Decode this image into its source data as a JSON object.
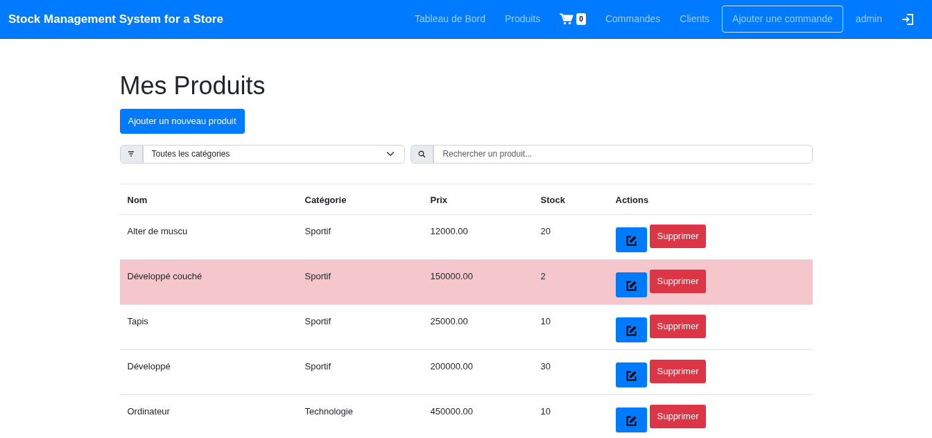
{
  "navbar": {
    "brand": "Stock Management System for a Store",
    "links": [
      {
        "kind": "link",
        "label": "Tableau de Bord"
      },
      {
        "kind": "link",
        "label": "Produits"
      },
      {
        "kind": "cart",
        "count": "0"
      },
      {
        "kind": "link",
        "label": "Commandes"
      },
      {
        "kind": "link",
        "label": "Clients"
      },
      {
        "kind": "outline",
        "label": "Ajouter une commande"
      },
      {
        "kind": "link",
        "label": "admin"
      },
      {
        "kind": "logout"
      }
    ]
  },
  "page": {
    "title": "Mes Produits",
    "add_button": "Ajouter un nouveau produit",
    "category_filter": {
      "value": "Toutes les catégories"
    },
    "search": {
      "placeholder": "Rechercher un produit..."
    }
  },
  "table": {
    "columns": [
      "Nom",
      "Catégorie",
      "Prix",
      "Stock",
      "Actions"
    ],
    "rows": [
      {
        "name": "Alter de muscu",
        "category": "Sportif",
        "price": "12000.00",
        "stock": "20",
        "low_stock": false,
        "delete_label": "Supprimer"
      },
      {
        "name": "Développé couché",
        "category": "Sportif",
        "price": "150000.00",
        "stock": "2",
        "low_stock": true,
        "delete_label": "Supprimer"
      },
      {
        "name": "Tapis",
        "category": "Sportif",
        "price": "25000.00",
        "stock": "10",
        "low_stock": false,
        "delete_label": "Supprimer"
      },
      {
        "name": "Développé",
        "category": "Sportif",
        "price": "200000.00",
        "stock": "30",
        "low_stock": false,
        "delete_label": "Supprimer"
      },
      {
        "name": "Ordinateur",
        "category": "Technologie",
        "price": "450000.00",
        "stock": "10",
        "low_stock": false,
        "delete_label": "Supprimer"
      }
    ]
  }
}
